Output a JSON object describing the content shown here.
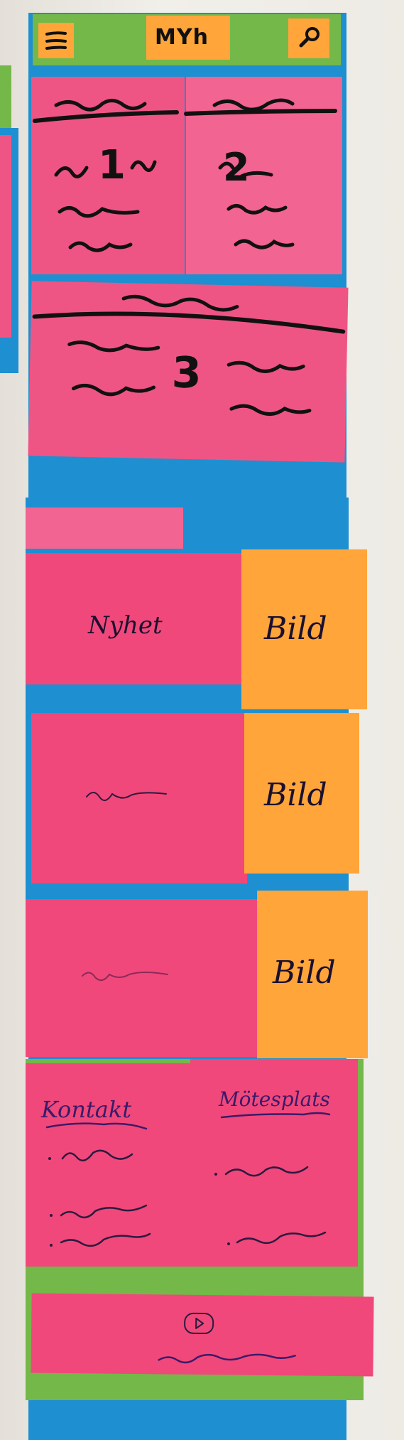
{
  "header": {
    "logo": "MYh"
  },
  "cards": {
    "card1": "1",
    "card2": "2",
    "card3": "3"
  },
  "news": [
    {
      "title": "Nyhet",
      "image": "Bild"
    },
    {
      "title": "",
      "image": "Bild"
    },
    {
      "title": "",
      "image": "Bild"
    }
  ],
  "footer": {
    "contact": "Kontakt",
    "venue": "Mötesplats"
  },
  "colors": {
    "pink": "#f0487a",
    "orange": "#ffa53a",
    "blue": "#1e8fd0",
    "green": "#74b849"
  }
}
